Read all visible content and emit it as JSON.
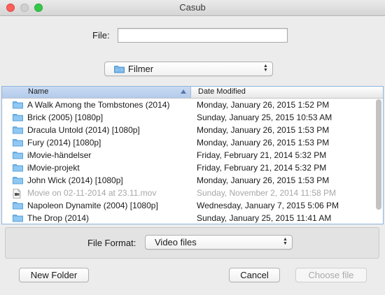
{
  "window": {
    "title": "Casub"
  },
  "file_field": {
    "label": "File:",
    "value": "",
    "placeholder": ""
  },
  "location": {
    "selected": "Filmer",
    "icon": "folder-icon"
  },
  "file_list": {
    "columns": {
      "name": "Name",
      "date_modified": "Date Modified",
      "sort_column": "name",
      "sort_direction": "ascending"
    },
    "rows": [
      {
        "name": "A Walk Among the Tombstones (2014)",
        "date": "Monday, January 26, 2015 1:52 PM",
        "type": "folder",
        "enabled": true
      },
      {
        "name": "Brick (2005) [1080p]",
        "date": "Sunday, January 25, 2015 10:53 AM",
        "type": "folder",
        "enabled": true
      },
      {
        "name": "Dracula Untold (2014) [1080p]",
        "date": "Monday, January 26, 2015 1:53 PM",
        "type": "folder",
        "enabled": true
      },
      {
        "name": "Fury (2014) [1080p]",
        "date": "Monday, January 26, 2015 1:53 PM",
        "type": "folder",
        "enabled": true
      },
      {
        "name": "iMovie-händelser",
        "date": "Friday, February 21, 2014 5:32 PM",
        "type": "folder",
        "enabled": true
      },
      {
        "name": "iMovie-projekt",
        "date": "Friday, February 21, 2014 5:32 PM",
        "type": "folder",
        "enabled": true
      },
      {
        "name": "John Wick (2014) [1080p]",
        "date": "Monday, January 26, 2015 1:53 PM",
        "type": "folder",
        "enabled": true
      },
      {
        "name": "Movie on 02-11-2014 at 23.11.mov",
        "date": "Sunday, November 2, 2014 11:58 PM",
        "type": "movie-file",
        "enabled": false
      },
      {
        "name": "Napoleon Dynamite (2004) [1080p]",
        "date": "Wednesday, January 7, 2015 5:06 PM",
        "type": "folder",
        "enabled": true
      },
      {
        "name": "The Drop (2014)",
        "date": "Sunday, January 25, 2015 11:41 AM",
        "type": "folder",
        "enabled": true
      }
    ]
  },
  "file_format": {
    "label": "File Format:",
    "selected": "Video files"
  },
  "buttons": {
    "new_folder": "New Folder",
    "cancel": "Cancel",
    "choose_file": "Choose file"
  },
  "colors": {
    "folder": "#6cb4ea",
    "header_selected": "#b9cfee",
    "disabled_text": "#a7a7a7",
    "close": "#fc605b",
    "maximize": "#34c84a"
  }
}
